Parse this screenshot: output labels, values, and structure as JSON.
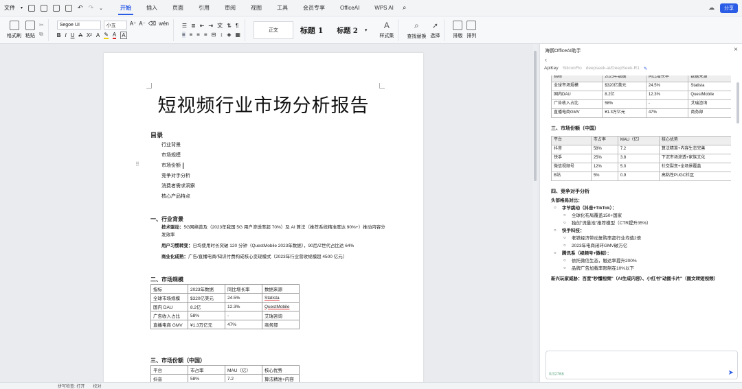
{
  "menubar": {
    "file_label": "文件",
    "tabs": [
      {
        "label": "开始",
        "active": true
      },
      {
        "label": "插入"
      },
      {
        "label": "页面"
      },
      {
        "label": "引用"
      },
      {
        "label": "审阅"
      },
      {
        "label": "视图"
      },
      {
        "label": "工具"
      },
      {
        "label": "会员专享"
      },
      {
        "label": "OfficeAI"
      },
      {
        "label": "WPS AI"
      }
    ],
    "share_label": "分享"
  },
  "ribbon": {
    "format_painter": "格式刷",
    "paste": "粘贴",
    "font_name": "Segoe UI",
    "font_size": "小五",
    "style_normal": "正文",
    "style_h1": "标题 1",
    "style_h2": "标题 2",
    "style_set": "样式集",
    "find_replace": "查找替换",
    "select": "选择",
    "layout": "排版",
    "arrange": "排列"
  },
  "doc": {
    "title": "短视频行业市场分析报告",
    "toc_heading": "目录",
    "toc": [
      "行业背景",
      "市场规模",
      "市场份额",
      "竞争对手分析",
      "消费者需求洞察",
      "核心产品特点"
    ],
    "s1_heading": "一、行业背景",
    "p1_label": "技术驱动：",
    "p1_text": "5G网络普及（2023年我国 5G 用户渗透率超 70%）及 AI 算法（推荐系统精准度达 90%+）推动内容分发效率",
    "p2_label": "用户习惯转变：",
    "p2_text": "日均使用时长突破 120 分钟（QuestMobile 2023年数据），90后/Z世代占比达 64%",
    "p3_label": "商业化成熟：",
    "p3_text": "广告/直播电商/知识付费构成核心变现模式（2023年行业营收规模超 4500 亿元）",
    "s2_heading": "二、市场规模",
    "t1": [
      [
        "指标",
        "2023年数据",
        "同比增长率",
        "数据来源"
      ],
      [
        "全球市场规模",
        "$320亿美元",
        "24.5%",
        "Statista"
      ],
      [
        "国内 DAU",
        "8.2亿",
        "12.3%",
        "QuestMobile"
      ],
      [
        "广告收入占比",
        "58%",
        "-",
        "艾瑞咨询"
      ],
      [
        "直播电商 GMV",
        "¥1.3万亿元",
        "47%",
        "商务部"
      ]
    ],
    "s3_heading": "三、市场份额（中国）",
    "t2": [
      [
        "平台",
        "市占率",
        "MAU（亿）",
        "核心优势"
      ],
      [
        "抖音",
        "58%",
        "7.2",
        "算法精准+内容"
      ]
    ]
  },
  "panel": {
    "title": "海鹦OfficeAI助手",
    "apikey_label": "ApiKey",
    "provider": "SiliconFlo",
    "model": "deepseek-ai/DeepSeek-R1",
    "t1": [
      [
        "指标",
        "2023年数据",
        "同比增长率",
        "数据来源"
      ],
      [
        "全球市场规模",
        "$320亿美元",
        "24.5%",
        "Statista"
      ],
      [
        "国内DAU",
        "8.2亿",
        "12.3%",
        "QuestMobile"
      ],
      [
        "广告收入占比",
        "58%",
        "-",
        "艾瑞咨询"
      ],
      [
        "直播电商GMV",
        "¥1.3万亿元",
        "47%",
        "商务部"
      ]
    ],
    "s3_heading": "三、市场份额（中国）",
    "t2": [
      [
        "平台",
        "市占率",
        "MAU（亿）",
        "核心优势"
      ],
      [
        "抖音",
        "58%",
        "7.2",
        "算法精准+内容生态完善"
      ],
      [
        "快手",
        "25%",
        "3.8",
        "下沉市场渗透+家族文化"
      ],
      [
        "微信视频号",
        "12%",
        "5.0",
        "社交裂变+全场景覆盖"
      ],
      [
        "B站",
        "5%",
        "0.9",
        "高粘性PUGC社区"
      ]
    ],
    "s4_heading": "四、竞争对手分析",
    "s4_sub": "头部格局对比：",
    "bullets": [
      {
        "level": 1,
        "text": "字节跳动（抖音+TikTok）：",
        "bold": true
      },
      {
        "level": 2,
        "text": "全球化布局覆盖150+国家"
      },
      {
        "level": 2,
        "text": "独创\"流量池\"推荐模型（CTR提升35%）"
      },
      {
        "level": 1,
        "text": "快手科技：",
        "bold": true
      },
      {
        "level": 2,
        "text": "老铁经济带动复购率超行业均值2倍"
      },
      {
        "level": 2,
        "text": "2023年电商闭环GMV破万亿"
      },
      {
        "level": 1,
        "text": "腾讯系（视频号+微视）：",
        "bold": true
      },
      {
        "level": 2,
        "text": "依托微信生态，触达率提升200%"
      },
      {
        "level": 2,
        "text": "品牌广告加载率限制在10%以下"
      }
    ],
    "note": "新兴玩家威胁：百度\"秒懂视频\"（AI生成内容）、小红书\"动图卡片\"（图文转短视频）",
    "counter": "0/32768"
  },
  "status": {
    "spell": "拼写检查: 打开",
    "proofread": "校对"
  }
}
